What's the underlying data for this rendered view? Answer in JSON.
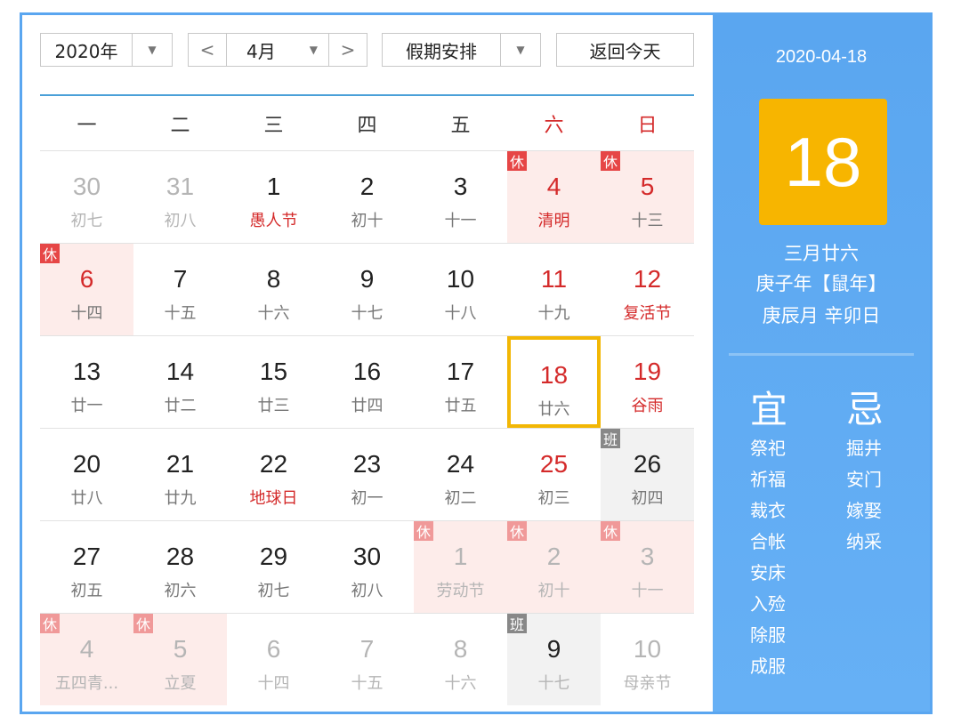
{
  "toolbar": {
    "year": "2020年",
    "prev": "<",
    "month": "4月",
    "next": ">",
    "holiday": "假期安排",
    "today": "返回今天"
  },
  "weekdays": [
    "一",
    "二",
    "三",
    "四",
    "五",
    "六",
    "日"
  ],
  "weeks": [
    [
      {
        "n": "30",
        "l": "初七",
        "other": true
      },
      {
        "n": "31",
        "l": "初八",
        "other": true
      },
      {
        "n": "1",
        "l": "愚人节",
        "fest": true
      },
      {
        "n": "2",
        "l": "初十"
      },
      {
        "n": "3",
        "l": "十一"
      },
      {
        "n": "4",
        "l": "清明",
        "badge": "休",
        "type": "holiday",
        "red": true,
        "fest": true
      },
      {
        "n": "5",
        "l": "十三",
        "badge": "休",
        "type": "holiday",
        "red": true
      }
    ],
    [
      {
        "n": "6",
        "l": "十四",
        "badge": "休",
        "type": "holiday",
        "red": true
      },
      {
        "n": "7",
        "l": "十五"
      },
      {
        "n": "8",
        "l": "十六"
      },
      {
        "n": "9",
        "l": "十七"
      },
      {
        "n": "10",
        "l": "十八"
      },
      {
        "n": "11",
        "l": "十九",
        "red": true
      },
      {
        "n": "12",
        "l": "复活节",
        "red": true,
        "fest": true
      }
    ],
    [
      {
        "n": "13",
        "l": "廿一"
      },
      {
        "n": "14",
        "l": "廿二"
      },
      {
        "n": "15",
        "l": "廿三"
      },
      {
        "n": "16",
        "l": "廿四"
      },
      {
        "n": "17",
        "l": "廿五"
      },
      {
        "n": "18",
        "l": "廿六",
        "red": true,
        "today": true
      },
      {
        "n": "19",
        "l": "谷雨",
        "red": true,
        "fest": true
      }
    ],
    [
      {
        "n": "20",
        "l": "廿八"
      },
      {
        "n": "21",
        "l": "廿九"
      },
      {
        "n": "22",
        "l": "地球日",
        "fest": true
      },
      {
        "n": "23",
        "l": "初一"
      },
      {
        "n": "24",
        "l": "初二"
      },
      {
        "n": "25",
        "l": "初三",
        "red": true
      },
      {
        "n": "26",
        "l": "初四",
        "badge": "班",
        "type": "work"
      }
    ],
    [
      {
        "n": "27",
        "l": "初五"
      },
      {
        "n": "28",
        "l": "初六"
      },
      {
        "n": "29",
        "l": "初七"
      },
      {
        "n": "30",
        "l": "初八"
      },
      {
        "n": "1",
        "l": "劳动节",
        "badge": "休",
        "type": "holiday",
        "other": true,
        "fest": true
      },
      {
        "n": "2",
        "l": "初十",
        "badge": "休",
        "type": "holiday",
        "other": true
      },
      {
        "n": "3",
        "l": "十一",
        "badge": "休",
        "type": "holiday",
        "other": true
      }
    ],
    [
      {
        "n": "4",
        "l": "五四青...",
        "badge": "休",
        "type": "holiday",
        "other": true
      },
      {
        "n": "5",
        "l": "立夏",
        "badge": "休",
        "type": "holiday",
        "other": true
      },
      {
        "n": "6",
        "l": "十四",
        "other": true
      },
      {
        "n": "7",
        "l": "十五",
        "other": true
      },
      {
        "n": "8",
        "l": "十六",
        "other": true
      },
      {
        "n": "9",
        "l": "十七",
        "badge": "班",
        "type": "work",
        "otherlunar": true
      },
      {
        "n": "10",
        "l": "母亲节",
        "other": true
      }
    ]
  ],
  "side": {
    "date": "2020-04-18",
    "day": "18",
    "lunar": "三月廿六",
    "ganzhi_year": "庚子年【鼠年】",
    "ganzhi_md": "庚辰月 辛卯日",
    "yi_title": "宜",
    "ji_title": "忌",
    "yi": [
      "祭祀",
      "祈福",
      "裁衣",
      "合帐",
      "安床",
      "入殓",
      "除服",
      "成服"
    ],
    "ji": [
      "掘井",
      "安门",
      "嫁娶",
      "纳采"
    ]
  },
  "colors": {
    "accent": "#5aa6f0",
    "holiday_bg": "#fdecea",
    "red": "#d42a2a",
    "today_border": "#f2b705",
    "big_box": "#f7b500"
  }
}
